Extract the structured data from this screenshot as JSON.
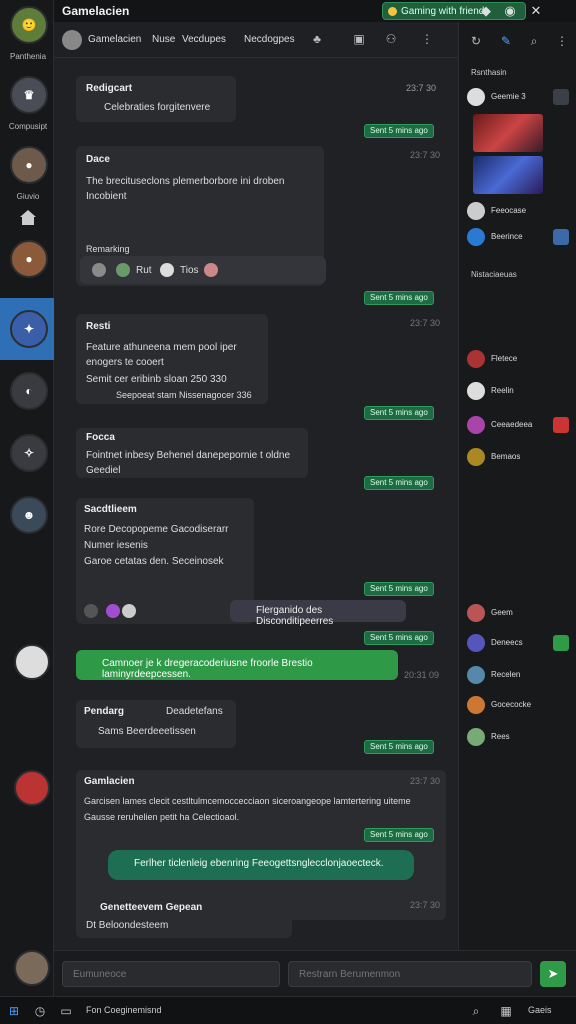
{
  "window": {
    "title": "Gamelacien",
    "status_label": "Gaming with friends"
  },
  "rail": {
    "items": [
      {
        "label": "Panthenia"
      },
      {
        "label": "Compusipt"
      },
      {
        "label": "Giuvio"
      }
    ]
  },
  "channel": {
    "name": "Gamelacien",
    "tab1": "Nuse",
    "tab2": "Vecdupes",
    "tab3": "Necdogpes"
  },
  "messages": [
    {
      "name": "Redigcart",
      "time": "23:7 30",
      "text": "Celebraties forgitenvere",
      "sent": "Sent 5 mins ago"
    },
    {
      "name": "Dace",
      "time": "23:7 30",
      "text": "The brecituseclons plemerborbore ini droben Incobient",
      "sub": "Remarking",
      "people": [
        "Rut",
        "Tios"
      ],
      "sent": "Sent 5 mins ago"
    },
    {
      "name": "Resti",
      "time": "23:7 30",
      "text": "Feature athuneena mem pool iper enogers te cooert",
      "text2": "Semit cer eribinb sloan 250 330",
      "text3": "Seepoeat stam Nissenagocer 336",
      "sent": "Sent 5 mins ago"
    },
    {
      "name": "Focca",
      "time": "",
      "text": "Fointnet inbesy Behenel danepepornie t oldne Geediel",
      "sent": "Sent 5 mins ago"
    },
    {
      "name": "Sacdtlieem",
      "time": "",
      "text": "Rore Decopopeme Gacodiserarr",
      "text2": "Numer iesenis",
      "text3": "Garoe cetatas den. Seceinosek",
      "tag": "Flerganido des Disconditipeerres",
      "sent": "Sent 5 mins ago"
    },
    {
      "name": "",
      "time": "20:31 09",
      "text": "Camnoer je k dregeracoderiusne froorle Brestio laminyrdeepcessen.",
      "sent": ""
    },
    {
      "name": "Pendarg",
      "time": "",
      "text": "Sams Beerdeeetissen",
      "extra": "Deadetefans",
      "sent": "Sent 5 mins ago"
    },
    {
      "name": "Gamlacien",
      "time": "23:7 30",
      "text": "Garcisen lames clecit cestltulmcemoccecciaon siceroangeope lamtertering uiteme",
      "text2": "Gausse reruhelien petit ha Celectioaol.",
      "reply": "Ferlher ticlenleig ebenring Feeogettsnglecclonjaoecteck.",
      "sent": "Sent 5 mins ago"
    },
    {
      "name": "Genetteevem Gepean",
      "time": "23:7 30",
      "text": "Dt Beloondesteem",
      "sent": ""
    }
  ],
  "right_panel": {
    "section1": "Rsnthasin",
    "items1": [
      "Geemie 3",
      "Feeocase",
      "Beerince"
    ],
    "section2": "Nistaciaeuas",
    "items2": [
      "Fletece",
      "Reelin",
      "Ceeaedeea",
      "Bemaos"
    ],
    "items3": [
      "Geem",
      "Deneecs",
      "Recelen",
      "Gocecocke",
      "Rees"
    ]
  },
  "composer": {
    "left_placeholder": "Eumuneoce",
    "right_placeholder": "Restrarn Berumenmon"
  },
  "taskbar": {
    "search_text": "Fon Coeginemisnd",
    "right_label": "Gaeis"
  }
}
